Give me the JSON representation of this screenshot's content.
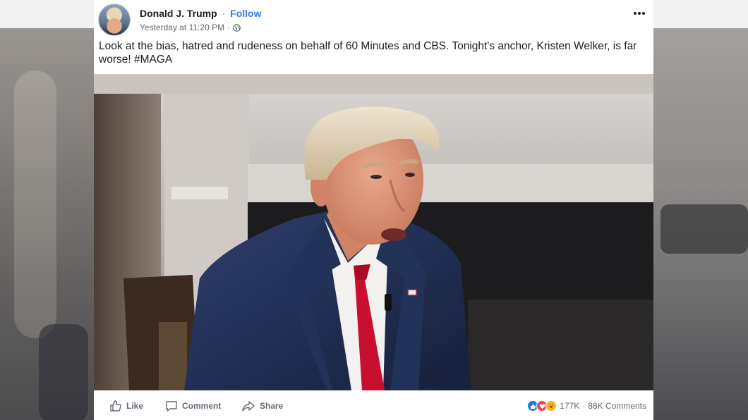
{
  "post": {
    "author": "Donald J. Trump",
    "separator": "·",
    "follow_label": "Follow",
    "timestamp": "Yesterday at 11:20 PM",
    "timestamp_separator": "·",
    "privacy_icon": "globe-icon",
    "text": "Look at the bias, hatred and rudeness on behalf of 60 Minutes and CBS. Tonight's anchor, Kristen Welker, is far worse! #MAGA"
  },
  "actions": {
    "like_label": "Like",
    "comment_label": "Comment",
    "share_label": "Share"
  },
  "stats": {
    "reactions": [
      "like",
      "love",
      "haha"
    ],
    "reaction_count": "177K",
    "separator": "·",
    "comments": "88K Comments"
  },
  "colors": {
    "follow_link": "#3578e5",
    "like_reaction": "#1877f2",
    "love_reaction": "#f33e58",
    "haha_reaction": "#f7b125",
    "tie": "#c8102e",
    "suit": "#1f2d4f"
  }
}
